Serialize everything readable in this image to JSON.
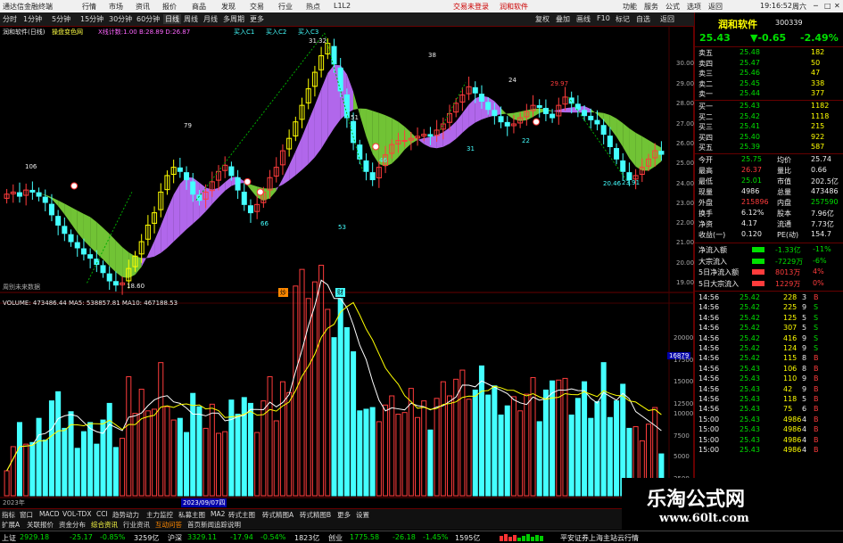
{
  "app": {
    "title": "通达信金融终端",
    "menu": [
      "行情",
      "市场",
      "资讯",
      "报价",
      "商品",
      "发现",
      "交易",
      "行业",
      "热点",
      "L1L2"
    ],
    "center_links": [
      "交易未登录",
      "润和软件"
    ],
    "right_menu": [
      "功能",
      "服务",
      "公式",
      "选项",
      "返回"
    ],
    "time": "19:16:52",
    "date_label": "周六"
  },
  "toolbar": {
    "periods": [
      "分时",
      "1分钟",
      "5分钟",
      "15分钟",
      "30分钟",
      "60分钟",
      "日线",
      "周线",
      "月线",
      "多周期",
      "更多"
    ],
    "active_period": "日线",
    "right_items": [
      "复权",
      "叠加",
      "画线",
      "F10",
      "标记",
      "自选",
      "返回"
    ]
  },
  "chart": {
    "title": "润和软件(日线)",
    "indicator_name": "操盘变色网",
    "indicator_stats": "X线计数:1.00  B:28.89  D:26.87",
    "signals": [
      "买入C1",
      "买入C2",
      "买入C3"
    ],
    "price_axis": [
      "30.00",
      "29.00",
      "28.00",
      "27.00",
      "26.00",
      "25.00",
      "24.00",
      "23.00",
      "22.00",
      "21.00",
      "20.00",
      "19.00"
    ],
    "annotations": [
      "106",
      "18.60",
      "79",
      "31.32",
      "66",
      "53",
      "51",
      "46",
      "38",
      "31",
      "24",
      "22",
      "29.97",
      "23.91",
      "20.46"
    ],
    "weekly_label": "周别未来数据",
    "volume_title": "VOLUME: 473486.44  MA5: 538857.81  MA10: 467188.53",
    "volume_axis": [
      "20000",
      "17500",
      "15000",
      "12500",
      "10000",
      "7500",
      "5000",
      "2500"
    ],
    "volume_highlight": "16879",
    "x_dates": [
      "2023年",
      "2023/09/07四"
    ],
    "markers": [
      "炒",
      "财"
    ]
  },
  "chart_data": {
    "type": "candlestick",
    "y_price_range": [
      19,
      31
    ],
    "closes": [
      23.5,
      23.6,
      23.4,
      23.7,
      23.6,
      23.4,
      23.1,
      22.5,
      22,
      21.6,
      21.2,
      20.9,
      20.6,
      20.4,
      20.1,
      19.7,
      19.3,
      19.1,
      19.2,
      19.9,
      20.5,
      21.2,
      22,
      22.6,
      23.6,
      24.4,
      24.8,
      24.6,
      24.2,
      23.5,
      23.2,
      23.6,
      24.1,
      24.6,
      24.9,
      24.4,
      23.7,
      23,
      22.6,
      23,
      23.6,
      24.3,
      24.8,
      25.6,
      26.2,
      27,
      27.8,
      28.6,
      29.4,
      30.2,
      30.8,
      29.8,
      28.5,
      27.2,
      26,
      25.2,
      24.6,
      24.2,
      24.8,
      25.4,
      25.9,
      26.1,
      26.1,
      26.2,
      26.3,
      26.4,
      26.3,
      26.6,
      26.9,
      27.4,
      27.9,
      28.3,
      28.7,
      28.4,
      28,
      27.6,
      27.3,
      27,
      26.8,
      26.9,
      27.2,
      27.5,
      27.8,
      27.7,
      27.4,
      27.2,
      27.8,
      28.2,
      27.9,
      27.6,
      27.3,
      27.1,
      26.9,
      26.4,
      25.8,
      25.2,
      24.6,
      24.2,
      24.4,
      24.8,
      25.2,
      25.6,
      25.43
    ],
    "volume_ma_note": "MA5 and MA10 overlays",
    "volume_range": [
      0,
      22500
    ]
  },
  "panel": {
    "stock_name": "润和软件",
    "stock_code": "300339",
    "price": "25.43",
    "change": "▼-0.65",
    "change_pct": "-2.49%",
    "asks": [
      {
        "label": "卖五",
        "price": "25.48",
        "vol": "182"
      },
      {
        "label": "卖四",
        "price": "25.47",
        "vol": "50"
      },
      {
        "label": "卖三",
        "price": "25.46",
        "vol": "47"
      },
      {
        "label": "卖二",
        "price": "25.45",
        "vol": "338"
      },
      {
        "label": "卖一",
        "price": "25.44",
        "vol": "377"
      }
    ],
    "bids": [
      {
        "label": "买一",
        "price": "25.43",
        "vol": "1182"
      },
      {
        "label": "买二",
        "price": "25.42",
        "vol": "1118"
      },
      {
        "label": "买三",
        "price": "25.41",
        "vol": "215"
      },
      {
        "label": "买四",
        "price": "25.40",
        "vol": "922"
      },
      {
        "label": "买五",
        "price": "25.39",
        "vol": "587"
      }
    ],
    "stats": [
      {
        "l1": "今开",
        "v1": "25.75",
        "l2": "均价",
        "v2": "25.74"
      },
      {
        "l1": "最高",
        "v1": "26.37",
        "l2": "量比",
        "v2": "0.66"
      },
      {
        "l1": "最低",
        "v1": "25.01",
        "l2": "市值",
        "v2": "202.5亿"
      },
      {
        "l1": "现量",
        "v1": "4986",
        "l2": "总量",
        "v2": "473486"
      },
      {
        "l1": "外盘",
        "v1": "215896",
        "l2": "内盘",
        "v2": "257590"
      },
      {
        "l1": "换手",
        "v1": "6.12%",
        "l2": "股本",
        "v2": "7.96亿"
      },
      {
        "l1": "净资",
        "v1": "4.17",
        "l2": "流通",
        "v2": "7.73亿"
      },
      {
        "l1": "收益(一)",
        "v1": "0.120",
        "l2": "PE(动)",
        "v2": "154.7"
      }
    ],
    "flows": [
      {
        "label": "净流入额",
        "value": "-1.33亿",
        "pct": "-11%"
      },
      {
        "label": "大宗流入",
        "value": "-7229万",
        "pct": "-6%"
      },
      {
        "label": "5日净流入额",
        "value": "8013万",
        "pct": "4%"
      },
      {
        "label": "5日大宗流入",
        "value": "1229万",
        "pct": "0%"
      }
    ],
    "ticks": [
      {
        "t": "14:56",
        "p": "25.42",
        "v": "228",
        "s": "3",
        "d": "B"
      },
      {
        "t": "14:56",
        "p": "25.42",
        "v": "225",
        "s": "9",
        "d": "S"
      },
      {
        "t": "14:56",
        "p": "25.42",
        "v": "125",
        "s": "5",
        "d": "S"
      },
      {
        "t": "14:56",
        "p": "25.42",
        "v": "307",
        "s": "5",
        "d": "S"
      },
      {
        "t": "14:56",
        "p": "25.42",
        "v": "416",
        "s": "9",
        "d": "S"
      },
      {
        "t": "14:56",
        "p": "25.42",
        "v": "124",
        "s": "9",
        "d": "S"
      },
      {
        "t": "14:56",
        "p": "25.42",
        "v": "115",
        "s": "8",
        "d": "B"
      },
      {
        "t": "14:56",
        "p": "25.43",
        "v": "106",
        "s": "8",
        "d": "B"
      },
      {
        "t": "14:56",
        "p": "25.43",
        "v": "110",
        "s": "9",
        "d": "B"
      },
      {
        "t": "14:56",
        "p": "25.43",
        "v": "42",
        "s": "9",
        "d": "B"
      },
      {
        "t": "14:56",
        "p": "25.43",
        "v": "118",
        "s": "5",
        "d": "B"
      },
      {
        "t": "14:56",
        "p": "25.43",
        "v": "75",
        "s": "6",
        "d": "B"
      },
      {
        "t": "15:00",
        "p": "25.43",
        "v": "4986",
        "s": "4",
        "d": "B"
      },
      {
        "t": "15:00",
        "p": "25.43",
        "v": "4986",
        "s": "4",
        "d": "B"
      },
      {
        "t": "15:00",
        "p": "25.43",
        "v": "4986",
        "s": "4",
        "d": "B"
      },
      {
        "t": "15:00",
        "p": "25.43",
        "v": "4986",
        "s": "4",
        "d": "B"
      }
    ]
  },
  "bottom_tabs": [
    "指标",
    "窗口",
    "MACD",
    "VOL-TDX",
    "CCI",
    "趋势动力",
    "主力监控",
    "私募主图",
    "MA2",
    "砖式主图",
    "砖式精图A",
    "砖式精图B",
    "更多",
    "设置"
  ],
  "fn_tabs": [
    "扩展A",
    "关联报价",
    "资金分布",
    "综合资讯",
    "行业资讯",
    "互动问答",
    "首页新闻追踪说明"
  ],
  "status": {
    "idx1_name": "上证",
    "idx1_val": "2929.18",
    "idx1_chg": "-25.17",
    "idx1_pct": "-0.85%",
    "idx1_amt": "3259亿",
    "idx2_name": "沪深",
    "idx2_val": "3329.11",
    "idx2_chg": "-17.94",
    "idx2_pct": "-0.54%",
    "idx2_amt": "1823亿",
    "idx3_name": "创业",
    "idx3_val": "1775.58",
    "idx3_chg": "-26.18",
    "idx3_pct": "-1.45%",
    "idx3_amt": "1595亿",
    "server": "平安证券上海主站云行情"
  },
  "watermark": {
    "line1": "乐淘公式网",
    "line2": "www.60lt.com"
  },
  "colors": {
    "up": "#ff3c3c",
    "down": "#00e000",
    "cyan_bar": "#4ff",
    "band_purple": "#c070ff",
    "band_green": "#7bd43a"
  }
}
